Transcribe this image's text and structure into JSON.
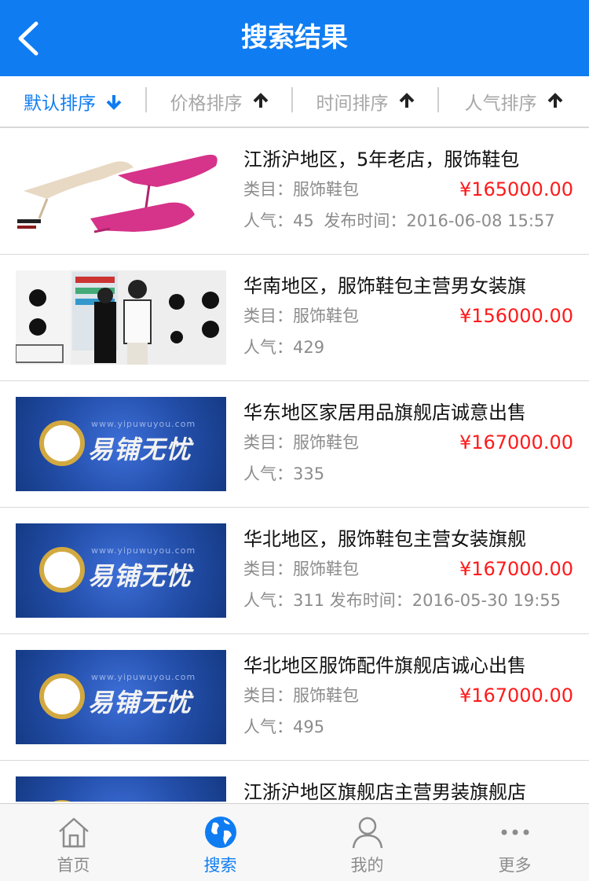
{
  "header": {
    "title": "搜索结果"
  },
  "sort": [
    {
      "label": "默认排序",
      "active": true,
      "dir": "down"
    },
    {
      "label": "价格排序",
      "active": false,
      "dir": "up"
    },
    {
      "label": "时间排序",
      "active": false,
      "dir": "up"
    },
    {
      "label": "人气排序",
      "active": false,
      "dir": "up"
    }
  ],
  "labels": {
    "category": "类目：",
    "popularity": "人气：",
    "published": "发布时间："
  },
  "brand": {
    "logo_text": "易铺无忧",
    "url": "www.yipuwuyou.com"
  },
  "items": [
    {
      "title": "江浙沪地区，5年老店，服饰鞋包",
      "category": "服饰鞋包",
      "price": "¥165000.00",
      "popularity": "45",
      "published": "2016-06-08 15:57",
      "thumb": "shoes"
    },
    {
      "title": "华南地区，服饰鞋包主营男女装旗",
      "category": "服饰鞋包",
      "price": "¥156000.00",
      "popularity": "429",
      "published": "",
      "thumb": "store"
    },
    {
      "title": "华东地区家居用品旗舰店诚意出售",
      "category": "服饰鞋包",
      "price": "¥167000.00",
      "popularity": "335",
      "published": "",
      "thumb": "brand"
    },
    {
      "title": "华北地区，服饰鞋包主营女装旗舰",
      "category": "服饰鞋包",
      "price": "¥167000.00",
      "popularity": "311",
      "published": "2016-05-30 19:55",
      "thumb": "brand"
    },
    {
      "title": "华北地区服饰配件旗舰店诚心出售",
      "category": "服饰鞋包",
      "price": "¥167000.00",
      "popularity": "495",
      "published": "",
      "thumb": "brand"
    },
    {
      "title": "江浙沪地区旗舰店主营男装旗舰店",
      "category": "",
      "price": "",
      "popularity": "",
      "published": "",
      "thumb": "brand"
    }
  ],
  "tabs": [
    {
      "label": "首页",
      "icon": "home-icon",
      "active": false
    },
    {
      "label": "搜索",
      "icon": "globe-icon",
      "active": true
    },
    {
      "label": "我的",
      "icon": "user-icon",
      "active": false
    },
    {
      "label": "更多",
      "icon": "more-icon",
      "active": false
    }
  ],
  "colors": {
    "accent": "#0f7cf2",
    "price": "#ff1a1a",
    "muted": "#8c8c8c"
  }
}
